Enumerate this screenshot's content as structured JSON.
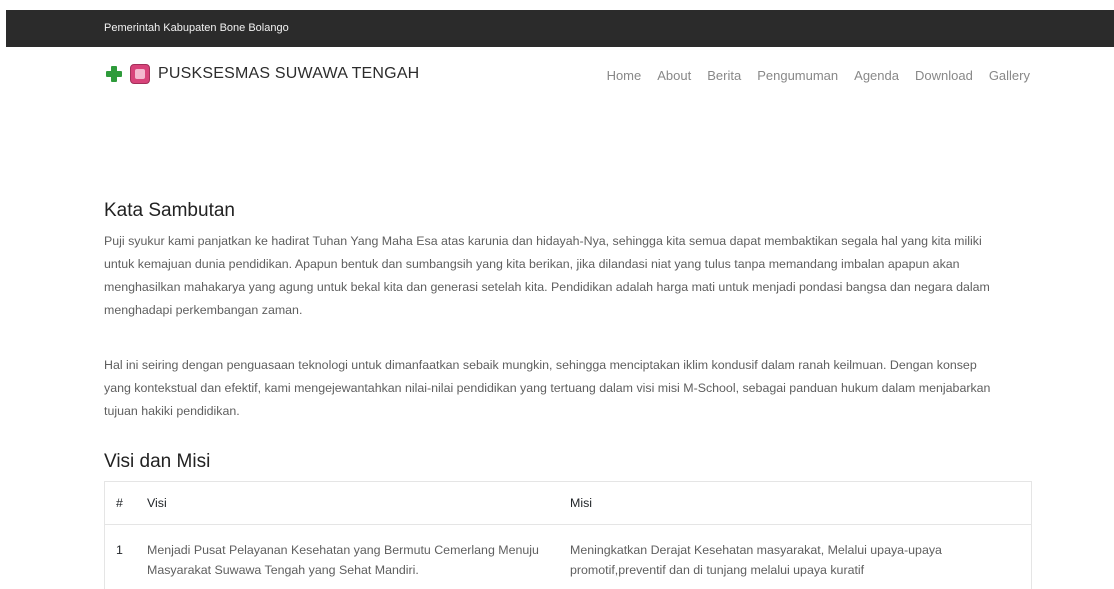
{
  "topbar": {
    "text": "Pemerintah Kabupaten Bone Bolango"
  },
  "brand": {
    "name": "PUSKSESMAS SUWAWA TENGAH"
  },
  "nav": {
    "items": [
      "Home",
      "About",
      "Berita",
      "Pengumuman",
      "Agenda",
      "Download",
      "Gallery"
    ]
  },
  "welcome": {
    "title": "Kata Sambutan",
    "paragraph1": "Puji syukur kami panjatkan ke hadirat Tuhan Yang Maha Esa atas karunia dan hidayah-Nya, sehingga kita semua dapat membaktikan segala hal yang kita miliki untuk kemajuan dunia pendidikan. Apapun bentuk dan sumbangsih yang kita berikan, jika dilandasi niat yang tulus tanpa memandang imbalan apapun akan menghasilkan mahakarya yang agung untuk bekal kita dan generasi setelah kita. Pendidikan adalah harga mati untuk menjadi pondasi bangsa dan negara dalam menghadapi perkembangan zaman.",
    "paragraph2": "Hal ini seiring dengan penguasaan teknologi untuk dimanfaatkan sebaik mungkin, sehingga menciptakan iklim kondusif dalam ranah keilmuan. Dengan konsep yang kontekstual dan efektif, kami mengejewantahkan nilai-nilai pendidikan yang tertuang dalam visi misi M-School, sebagai panduan hukum dalam menjabarkan tujuan hakiki pendidikan."
  },
  "visi_misi": {
    "title": "Visi dan Misi",
    "headers": {
      "num": "#",
      "visi": "Visi",
      "misi": "Misi"
    },
    "rows": [
      {
        "num": "1",
        "visi": "Menjadi Pusat Pelayanan Kesehatan yang Bermutu Cemerlang Menuju Masyarakat Suwawa Tengah yang Sehat Mandiri.",
        "misi": "Meningkatkan Derajat Kesehatan masyarakat, Melalui upaya-upaya promotif,preventif dan di tunjang melalui upaya kuratif"
      }
    ]
  }
}
